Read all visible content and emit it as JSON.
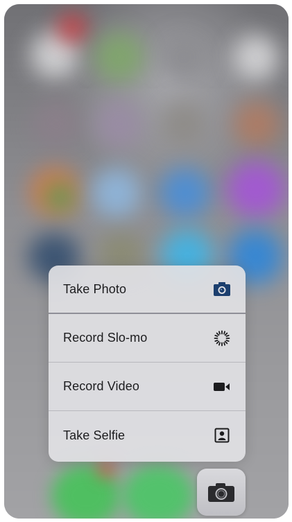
{
  "quick_actions": {
    "items": [
      {
        "label": "Take Photo",
        "icon": "camera-icon"
      },
      {
        "label": "Record Slo-mo",
        "icon": "slo-mo-icon"
      },
      {
        "label": "Record Video",
        "icon": "video-camera-icon"
      },
      {
        "label": "Take Selfie",
        "icon": "selfie-portrait-icon"
      }
    ]
  },
  "app_icon": {
    "name": "camera-app-icon"
  },
  "colors": {
    "menu_background": "#e2e2e6",
    "icon_accent": "#1c3f6e",
    "text": "#1c1c1e"
  }
}
